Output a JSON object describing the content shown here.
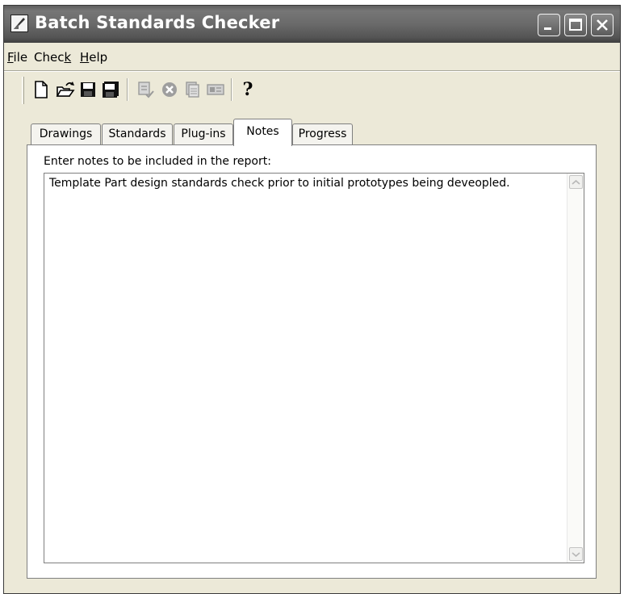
{
  "window": {
    "title": "Batch Standards Checker",
    "controls": [
      "minimize",
      "maximize",
      "close"
    ]
  },
  "menu": [
    {
      "pre": "",
      "acc": "F",
      "post": "ile"
    },
    {
      "pre": "Chec",
      "acc": "k",
      "post": ""
    },
    {
      "pre": "",
      "acc": "H",
      "post": "elp"
    }
  ],
  "toolbar": {
    "buttons": [
      "new-icon",
      "open-icon",
      "save-icon",
      "save-as-icon",
      "check-icon",
      "stop-icon",
      "report-icon",
      "settings-icon",
      "help-icon"
    ],
    "help_glyph": "?"
  },
  "tabs": [
    "Drawings",
    "Standards",
    "Plug-ins",
    "Notes",
    "Progress"
  ],
  "active_tab": "Notes",
  "notes": {
    "label": "Enter notes to be included in the report:",
    "text": "Template Part design standards check prior to initial prototypes being deveopled."
  },
  "colors": {
    "titlebar": "#6a6a6a",
    "window_bg": "#ece9d8",
    "panel_bg": "#ffffff"
  }
}
